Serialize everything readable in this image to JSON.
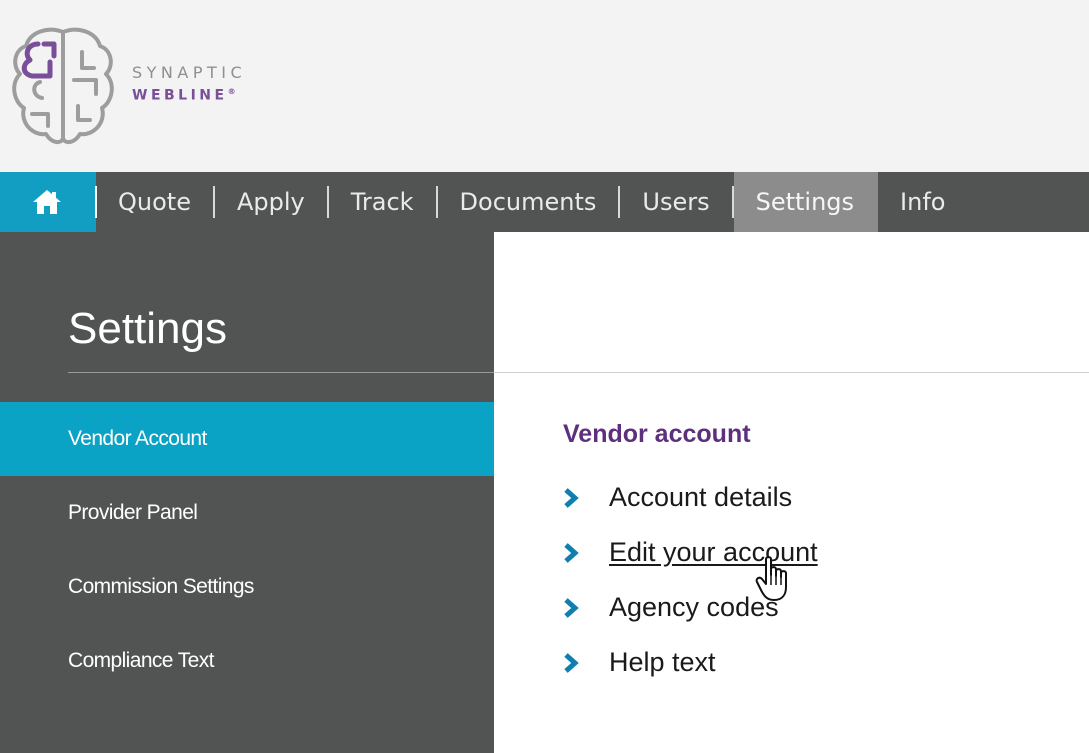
{
  "brand": {
    "line1": "SYNAPTIC",
    "line2": "WEBLINE",
    "reg": "®"
  },
  "nav": {
    "home_icon": "home-icon",
    "items": [
      "Quote",
      "Apply",
      "Track",
      "Documents",
      "Users",
      "Settings",
      "Info"
    ],
    "active": "Settings"
  },
  "sidebar": {
    "title": "Settings",
    "items": [
      "Vendor Account",
      "Provider Panel",
      "Commission Settings",
      "Compliance Text"
    ],
    "active": "Vendor Account"
  },
  "main": {
    "section_title": "Vendor account",
    "links": [
      "Account details",
      "Edit your account",
      "Agency codes",
      "Help text"
    ],
    "hovered": "Edit your account"
  },
  "colors": {
    "accent": "#0ba3c5",
    "nav_bg": "#525353",
    "active_nav": "#8c8c8c",
    "title_purple": "#5d2f7c",
    "chevron": "#0e7fae"
  }
}
